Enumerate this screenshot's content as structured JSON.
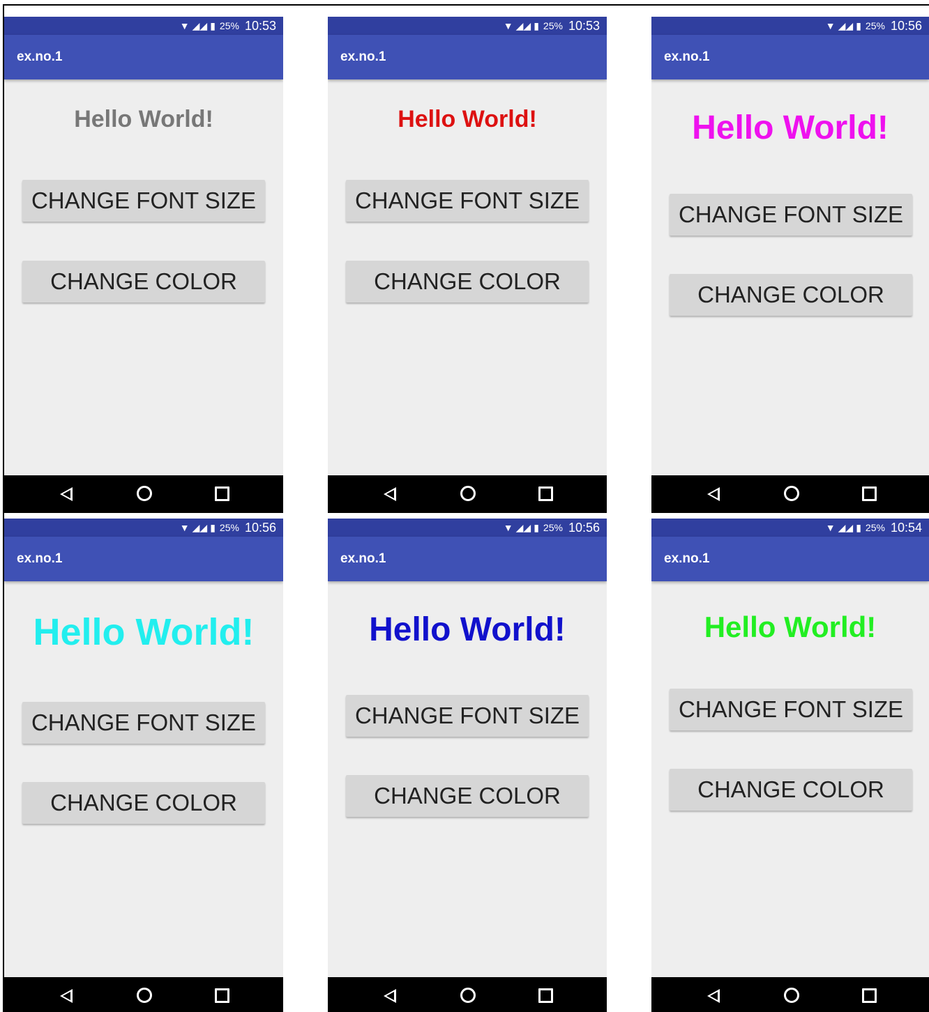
{
  "app_title": "ex.no.1",
  "button_font_size_label": "CHANGE FONT SIZE",
  "button_color_label": "CHANGE COLOR",
  "status_battery": "25%",
  "nav_icons": [
    "back-icon",
    "home-icon",
    "recents-icon"
  ],
  "screens": [
    {
      "time": "10:53",
      "hello_text": "Hello World!",
      "hello_color": "#777777"
    },
    {
      "time": "10:53",
      "hello_text": "Hello World!",
      "hello_color": "#dd1111"
    },
    {
      "time": "10:56",
      "hello_text": "Hello World!",
      "hello_color": "#ee11ee"
    },
    {
      "time": "10:56",
      "hello_text": "Hello World!",
      "hello_color": "#22eeee"
    },
    {
      "time": "10:56",
      "hello_text": "Hello World!",
      "hello_color": "#1111cc"
    },
    {
      "time": "10:54",
      "hello_text": "Hello World!",
      "hello_color": "#22ee22"
    }
  ]
}
